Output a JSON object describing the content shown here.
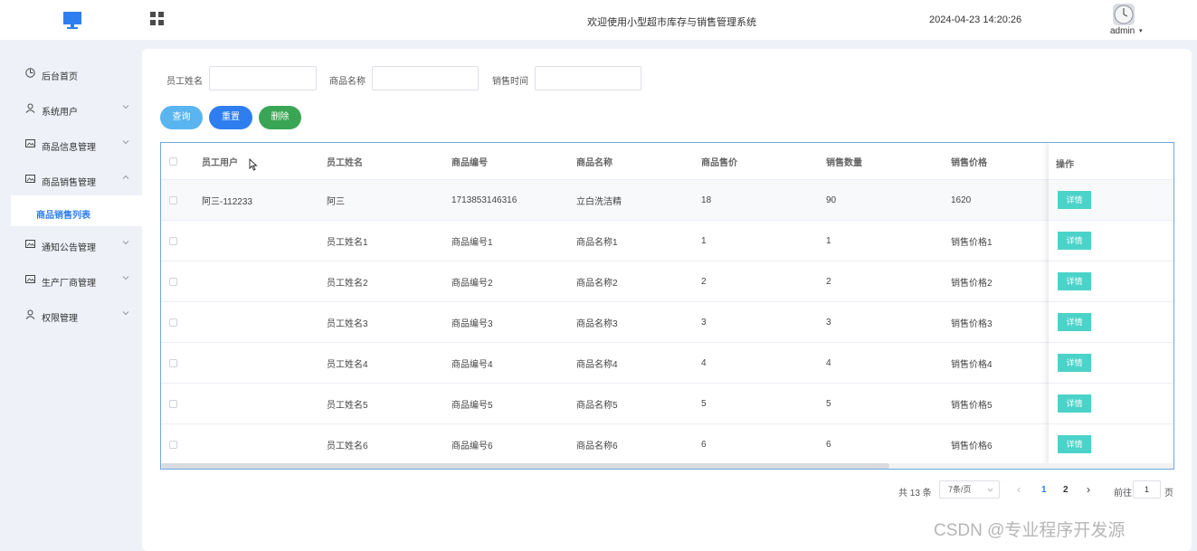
{
  "header": {
    "system_title": "欢迎使用小型超市库存与销售管理系统",
    "datetime": "2024-04-23 14:20:26",
    "user": "admin",
    "logo_icon": "monitor-icon",
    "menu_icon": "grid-icon",
    "accent": "#2f7ef0"
  },
  "sidebar": {
    "items": [
      {
        "label": "后台首页",
        "icon": "clock-icon"
      },
      {
        "label": "系统用户",
        "icon": "user-icon"
      },
      {
        "label": "商品信息管理",
        "icon": "picture-icon"
      },
      {
        "label": "商品销售管理",
        "icon": "picture-icon"
      },
      {
        "label": "通知公告管理",
        "icon": "picture-icon"
      },
      {
        "label": "生产厂商管理",
        "icon": "picture-icon"
      },
      {
        "label": "权限管理",
        "icon": "user-icon"
      }
    ],
    "active_sub": "商品销售列表"
  },
  "filters": {
    "employee_name_label": "员工姓名",
    "product_name_label": "商品名称",
    "sale_time_label": "销售时间",
    "employee_name_value": "",
    "product_name_value": "",
    "sale_time_value": ""
  },
  "buttons": {
    "query": "查询",
    "reset": "重置",
    "delete": "删除",
    "query_color": "#5ab4f0",
    "reset_color": "#2f7ef0",
    "delete_color": "#3aa655"
  },
  "table": {
    "columns": [
      "员工用户",
      "员工姓名",
      "商品编号",
      "商品名称",
      "商品售价",
      "销售数量",
      "销售价格",
      "操作"
    ],
    "detail_label": "详情",
    "rows": [
      [
        "阿三-112233",
        "阿三",
        "1713853146316",
        "立白洗洁精",
        "18",
        "90",
        "1620"
      ],
      [
        "",
        "员工姓名1",
        "商品编号1",
        "商品名称1",
        "1",
        "1",
        "销售价格1"
      ],
      [
        "",
        "员工姓名2",
        "商品编号2",
        "商品名称2",
        "2",
        "2",
        "销售价格2"
      ],
      [
        "",
        "员工姓名3",
        "商品编号3",
        "商品名称3",
        "3",
        "3",
        "销售价格3"
      ],
      [
        "",
        "员工姓名4",
        "商品编号4",
        "商品名称4",
        "4",
        "4",
        "销售价格4"
      ],
      [
        "",
        "员工姓名5",
        "商品编号5",
        "商品名称5",
        "5",
        "5",
        "销售价格5"
      ],
      [
        "",
        "员工姓名6",
        "商品编号6",
        "商品名称6",
        "6",
        "6",
        "销售价格6"
      ]
    ]
  },
  "pagination": {
    "total": "共 13 条",
    "page_size": "7条/页",
    "prev": "‹",
    "pages": [
      "1",
      "2"
    ],
    "current": "1",
    "next": "›",
    "goto_label": "前往",
    "goto_value": "1",
    "page_suffix": "页"
  },
  "watermark": "CSDN @专业程序开发源"
}
